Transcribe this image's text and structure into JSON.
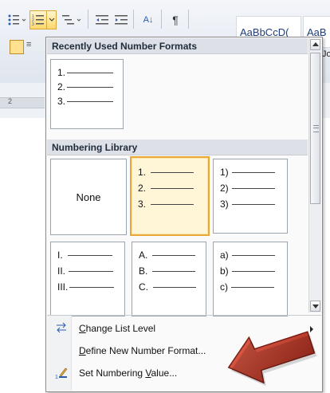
{
  "toolbar": {
    "paragraph_mark": "¶",
    "sort_glyph": "A↓",
    "styles": [
      "AaBbCcD(",
      "AaB"
    ],
    "right_edge_text": "Jo"
  },
  "ruler": {
    "mark": "2"
  },
  "dropdown": {
    "recent_header": "Recently Used Number Formats",
    "recent_tiles": [
      {
        "items": [
          "1.",
          "2.",
          "3."
        ]
      }
    ],
    "library_header": "Numbering Library",
    "library_tiles": [
      {
        "none_label": "None",
        "items": []
      },
      {
        "items": [
          "1.",
          "2.",
          "3."
        ],
        "selected": true
      },
      {
        "items": [
          "1)",
          "2)",
          "3)"
        ]
      },
      {
        "items": [
          "I.",
          "II.",
          "III."
        ]
      },
      {
        "items": [
          "A.",
          "B.",
          "C."
        ]
      },
      {
        "items": [
          "a)",
          "b)",
          "c)"
        ]
      }
    ],
    "menu_items": [
      {
        "label": "Change List Level",
        "icon": "change-level-icon",
        "has_submenu": true,
        "underline": "C"
      },
      {
        "label": "Define New Number Format...",
        "icon": "",
        "has_submenu": false,
        "underline": "D"
      },
      {
        "label": "Set Numbering Value...",
        "icon": "set-value-icon",
        "has_submenu": false,
        "underline": "V"
      }
    ]
  },
  "colors": {
    "accent_selected": "#e8a93a",
    "annotation_arrow": "#c0392b"
  }
}
